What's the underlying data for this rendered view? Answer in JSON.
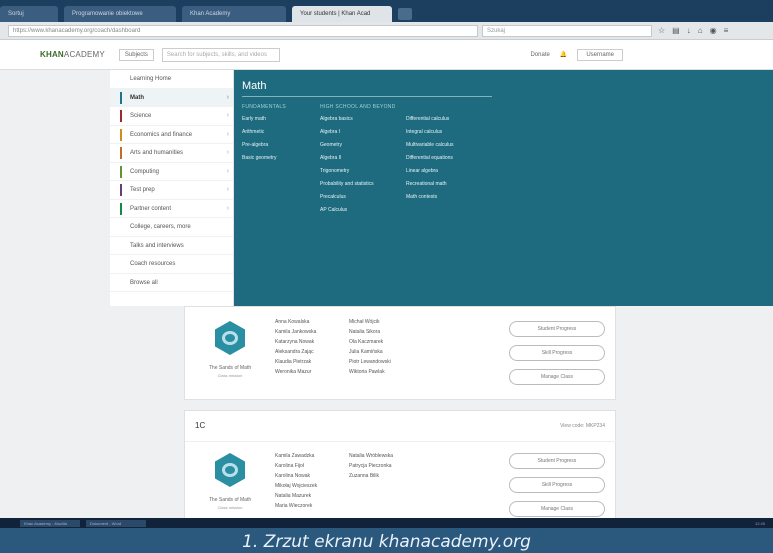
{
  "browser": {
    "tabs": [
      {
        "label": "Sortuj"
      },
      {
        "label": "Programowanie obiektowe"
      },
      {
        "label": "Khan Academy"
      },
      {
        "label": "Your students | Khan Acad"
      }
    ],
    "url": "https://www.khanacademy.org/coach/dashboard",
    "search_placeholder": "Szukaj"
  },
  "header": {
    "logo": "KHAN",
    "logo_suffix": "ACADEMY",
    "subjects": "Subjects",
    "search_placeholder": "Search for subjects, skills, and videos",
    "donate": "Donate",
    "user": "Username"
  },
  "sidemenu": {
    "items": [
      {
        "label": "Learning Home",
        "color": "#ffffff"
      },
      {
        "label": "Math",
        "color": "#1c758a"
      },
      {
        "label": "Science",
        "color": "#9c2b2b"
      },
      {
        "label": "Economics and finance",
        "color": "#d08d1c"
      },
      {
        "label": "Arts and humanities",
        "color": "#c46b2b"
      },
      {
        "label": "Computing",
        "color": "#5e9732"
      },
      {
        "label": "Test prep",
        "color": "#644172"
      },
      {
        "label": "Partner content",
        "color": "#138a4a"
      },
      {
        "label": "College, careers, more",
        "color": "#ffffff"
      },
      {
        "label": "Talks and interviews",
        "color": "#ffffff"
      },
      {
        "label": "Coach resources",
        "color": "#ffffff"
      },
      {
        "label": "Browse all",
        "color": "#ffffff"
      }
    ]
  },
  "math": {
    "title": "Math",
    "col1_header": "FUNDAMENTALS",
    "col1": [
      "Early math",
      "Arithmetic",
      "Pre-algebra",
      "Basic geometry"
    ],
    "col2_header": "HIGH SCHOOL AND BEYOND",
    "col2": [
      "Algebra basics",
      "Algebra I",
      "Geometry",
      "Algebra II",
      "Trigonometry",
      "Probability and statistics",
      "Precalculus",
      "AP Calculus"
    ],
    "col3": [
      "Differential calculus",
      "Integral calculus",
      "Multivariable calculus",
      "Differential equations",
      "Linear algebra",
      "Recreational math",
      "Math contests"
    ]
  },
  "class1": {
    "badge": "The Sands of Math",
    "badge_sub": "Class mission",
    "names_a": [
      "Anna Kowalska",
      "Kamila Jankowska",
      "Katarzyna Nowak",
      "Aleksandra Zając",
      "Klaudia Pietrzak",
      "Weronika Mazur"
    ],
    "names_b": [
      "Michał Wójcik",
      "Natalia Sikora",
      "Ola Kaczmarek",
      "Julia Kamińska",
      "Piotr Lewandowski",
      "Wiktoria Pawlak"
    ],
    "btn_student": "Student Progress",
    "btn_skill": "Skill Progress",
    "btn_manage": "Manage Class"
  },
  "class2": {
    "title": "1C",
    "view_code": "View code: MKP234",
    "badge": "The Sands of Math",
    "badge_sub": "Class mission",
    "names_a": [
      "Kamila Zawadzka",
      "Karolina Fijoł",
      "Karolina Nowak",
      "Mikołaj Wojcieszek",
      "Natalia Mazurek",
      "Maria Wieczorek"
    ],
    "names_b": [
      "Natalia Wróblewska",
      "Patrycja Pieczonka",
      "Zuzanna Bilik"
    ],
    "btn_student": "Student Progress",
    "btn_skill": "Skill Progress",
    "btn_manage": "Manage Class"
  },
  "taskbar": {
    "items": [
      "Khan Academy - Mozilla",
      "Dokument - Word"
    ],
    "tray": "12:45"
  },
  "caption": "1. Zrzut ekranu khanacademy.org"
}
